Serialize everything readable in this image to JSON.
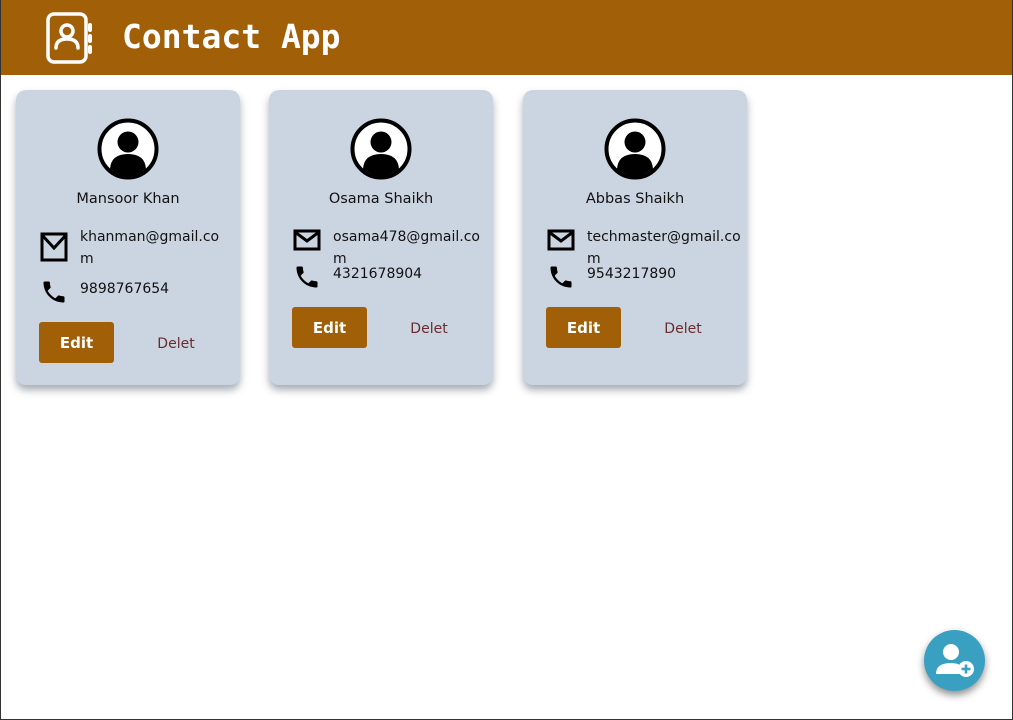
{
  "header": {
    "title": "Contact App",
    "logo_icon": "contact-book-icon",
    "background_color": "#a15f07"
  },
  "contacts": [
    {
      "name": "Mansoor Khan",
      "email": "khanman@gmail.com",
      "phone": "9898767654",
      "edit_label": "Edit",
      "delete_label": "Delet"
    },
    {
      "name": "Osama Shaikh",
      "email": "osama478@gmail.com",
      "phone": "4321678904",
      "edit_label": "Edit",
      "delete_label": "Delet"
    },
    {
      "name": "Abbas Shaikh",
      "email": "techmaster@gmail.com",
      "phone": "9543217890",
      "edit_label": "Edit",
      "delete_label": "Delet"
    }
  ],
  "fab": {
    "icon": "add-user-icon",
    "color": "#3aa0c2"
  },
  "colors": {
    "accent": "#a15f07",
    "card_background": "#cbd5e1",
    "delete_text": "#6b2b2b"
  }
}
